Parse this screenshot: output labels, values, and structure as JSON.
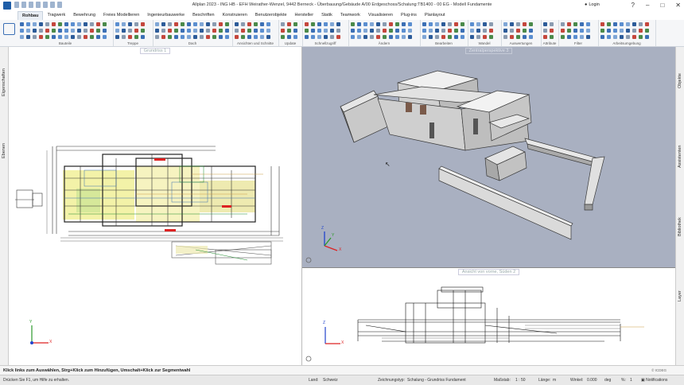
{
  "window": {
    "title": "Allplan 2023 - ING HB - EFH Weirather-Wenzel, 9442 Berneck - Überbauung/Gebäude A/00 Erdgeschoss/Schalung:TB1400 - 00 EG - Modell Fundamente",
    "login": "Login"
  },
  "tabs": [
    "Rohbau",
    "Tragwerk",
    "Bewehrung",
    "Freies Modellieren",
    "Ingenieurbauwerke",
    "Beschriften",
    "Konstruieren",
    "Benutzerobjekte",
    "Hersteller",
    "Statik",
    "Teamwork",
    "Visualisieren",
    "Plug-ins",
    "Planlayout"
  ],
  "ribbon_groups": [
    "Bauteile",
    "Treppe",
    "Dach",
    "Ansichten und Schnitte",
    "Update",
    "Schnellzugriff",
    "Ändern",
    "Bearbeiten",
    "Wandel",
    "Auswertungen",
    "Attribute",
    "Filter",
    "Arbeitsumgebung"
  ],
  "left_panels": [
    "Eigenschaften",
    "Ebenen"
  ],
  "right_panels": [
    "Objekte",
    "Assistenten",
    "Bibliothek",
    "Layer"
  ],
  "viewports": {
    "plan": "Grundriss 1",
    "persp": "Zentralperspektive 3",
    "front": "Ansicht von vorne, Süden 2"
  },
  "axis": {
    "x": "X",
    "y": "Y",
    "z": "Z"
  },
  "status": {
    "message": "Klick links zum Auswählen, Strg+Klick zum Hinzufügen, Umschalt+Klick zur Segmentwahl",
    "help": "Drücken Sie F1, um Hilfe zu erhalten.",
    "land_label": "Land:",
    "land_value": "Schweiz",
    "zeichnungstyp_label": "Zeichnungstyp:",
    "zeichnungstyp_value": "Schalung - Grundriss Fundament",
    "massstab_label": "Maßstab:",
    "massstab_value": "1 : 50",
    "laenge_label": "Länge:",
    "laenge_value": "m",
    "winkel_label": "Winkel:",
    "winkel_value": "0.000",
    "winkel_unit": "deg",
    "prozent_label": "%:",
    "prozent_value": "1",
    "notifications": "Notifications",
    "icon_badge": "© ICDEG"
  },
  "colors": {
    "persp_bg": "#a9b0c1",
    "accent": "#1f5ea8"
  }
}
